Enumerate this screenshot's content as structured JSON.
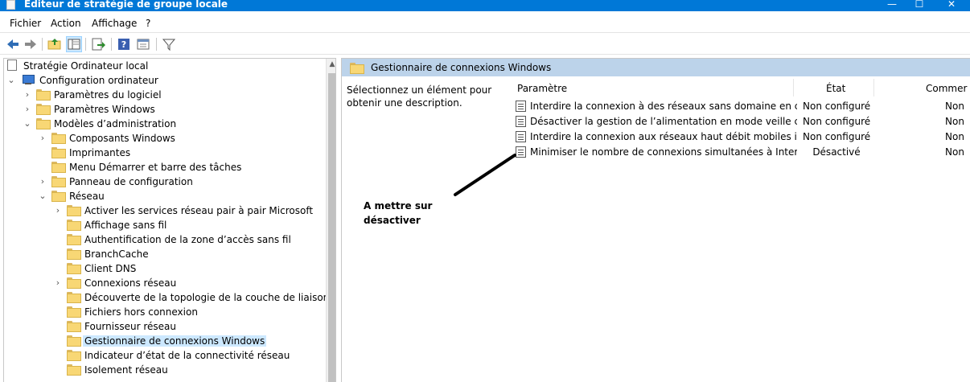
{
  "window": {
    "title": "Editeur de stratégie de groupe locale",
    "controls": {
      "minimize": "—",
      "maximize": "☐",
      "close": "✕"
    }
  },
  "menu": [
    "Fichier",
    "Action",
    "Affichage",
    "?"
  ],
  "toolbar": [
    "back-arrow-icon",
    "forward-arrow-icon",
    "up-folder-icon",
    "show-hide-tree-icon",
    "export-list-icon",
    "help-icon",
    "properties-icon",
    "filter-icon"
  ],
  "tree": {
    "items": [
      {
        "label": "Stratégie Ordinateur local"
      },
      {
        "label": "Configuration ordinateur"
      },
      {
        "label": "Paramètres du logiciel"
      },
      {
        "label": "Paramètres Windows"
      },
      {
        "label": "Modèles d’administration"
      },
      {
        "label": "Composants Windows"
      },
      {
        "label": "Imprimantes"
      },
      {
        "label": "Menu Démarrer et barre des tâches"
      },
      {
        "label": "Panneau de configuration"
      },
      {
        "label": "Réseau"
      },
      {
        "label": "Activer les services réseau pair à pair Microsoft"
      },
      {
        "label": "Affichage sans fil"
      },
      {
        "label": "Authentification de la zone d’accès sans fil"
      },
      {
        "label": "BranchCache"
      },
      {
        "label": "Client DNS"
      },
      {
        "label": "Connexions réseau"
      },
      {
        "label": "Découverte de la topologie de la couche de liaison"
      },
      {
        "label": "Fichiers hors connexion"
      },
      {
        "label": "Fournisseur réseau"
      },
      {
        "label": "Gestionnaire de connexions Windows"
      },
      {
        "label": "Indicateur d’état de la connectivité réseau"
      },
      {
        "label": "Isolement réseau"
      }
    ],
    "selected": "Gestionnaire de connexions Windows"
  },
  "details": {
    "header_title": "Gestionnaire de connexions Windows",
    "description": "Sélectionnez un élément pour obtenir une description.",
    "columns": {
      "setting": "Paramètre",
      "state": "État",
      "comment": "Commer"
    },
    "rows": [
      {
        "name": "Interdire la connexion à des réseaux sans domaine en cas de ...",
        "state": "Non configuré",
        "comment": "Non"
      },
      {
        "name": "Désactiver la gestion de l’alimentation en mode veille conne...",
        "state": "Non configuré",
        "comment": "Non"
      },
      {
        "name": "Interdire la connexion aux réseaux haut débit mobiles itinéra...",
        "state": "Non configuré",
        "comment": "Non"
      },
      {
        "name": "Minimiser le nombre de connexions simultanées à Internet ...",
        "state": "Désactivé",
        "comment": "Non"
      }
    ]
  },
  "annotation": {
    "text_line1": "A mettre sur",
    "text_line2": "désactiver"
  }
}
